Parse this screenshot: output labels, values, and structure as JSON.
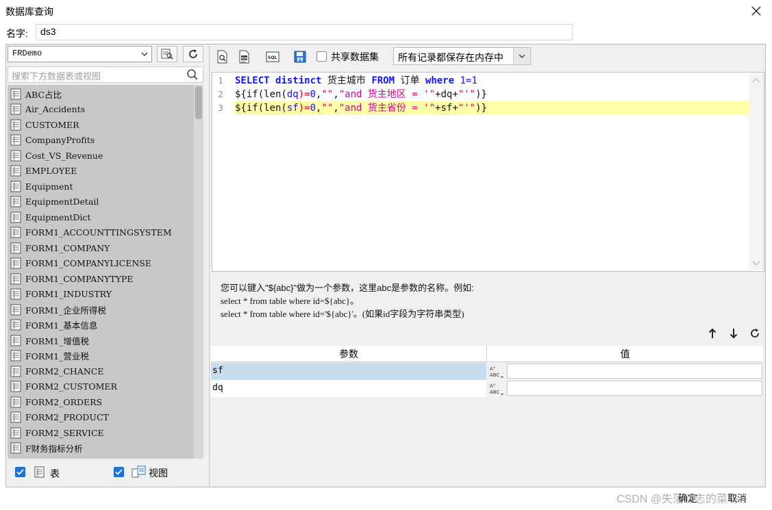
{
  "window": {
    "title": "数据库查询"
  },
  "name_field": {
    "label": "名字:",
    "value": "ds3"
  },
  "left": {
    "datasource": "FRDemo",
    "search_placeholder": "搜索下方数据表或视图",
    "tables": [
      "ABC占比",
      "Air_Accidents",
      "CUSTOMER",
      "CompanyProfits",
      "Cost_VS_Revenue",
      "EMPLOYEE",
      "Equipment",
      "EquipmentDetail",
      "EquipmentDict",
      "FORM1_ACCOUNTTINGSYSTEM",
      "FORM1_COMPANY",
      "FORM1_COMPANYLICENSE",
      "FORM1_COMPANYTYPE",
      "FORM1_INDUSTRY",
      "FORM1_企业所得税",
      "FORM1_基本信息",
      "FORM1_增值税",
      "FORM1_营业税",
      "FORM2_CHANCE",
      "FORM2_CUSTOMER",
      "FORM2_ORDERS",
      "FORM2_PRODUCT",
      "FORM2_SERVICE",
      "F财务指标分析"
    ],
    "filter_table_label": "表",
    "filter_view_label": "视图"
  },
  "toolbar": {
    "share_label": "共享数据集",
    "memory_option": "所有记录都保存在内存中"
  },
  "editor": {
    "lines": [
      {
        "num": "1",
        "highlight": false,
        "tokens": [
          {
            "t": "SELECT",
            "k": "kw"
          },
          {
            "t": " ",
            "k": "def"
          },
          {
            "t": "distinct",
            "k": "kw"
          },
          {
            "t": " 货主城市 ",
            "k": "def"
          },
          {
            "t": "FROM",
            "k": "kw"
          },
          {
            "t": " 订单 ",
            "k": "def"
          },
          {
            "t": "where",
            "k": "kw"
          },
          {
            "t": " ",
            "k": "def"
          },
          {
            "t": "1=1",
            "k": "num"
          }
        ]
      },
      {
        "num": "2",
        "highlight": false,
        "tokens": [
          {
            "t": "${if(len(",
            "k": "def"
          },
          {
            "t": "dq",
            "k": "num"
          },
          {
            "t": ")=",
            "k": "red"
          },
          {
            "t": "0",
            "k": "num"
          },
          {
            "t": ",",
            "k": "def"
          },
          {
            "t": "\"\"",
            "k": "str"
          },
          {
            "t": ",",
            "k": "def"
          },
          {
            "t": "\"and 货主地区 = '\"",
            "k": "str"
          },
          {
            "t": "+dq+",
            "k": "def"
          },
          {
            "t": "\"'\"",
            "k": "str"
          },
          {
            "t": ")}",
            "k": "def"
          }
        ]
      },
      {
        "num": "3",
        "highlight": true,
        "tokens": [
          {
            "t": "${if(len(",
            "k": "def"
          },
          {
            "t": "sf",
            "k": "num"
          },
          {
            "t": ")=",
            "k": "red"
          },
          {
            "t": "0",
            "k": "num"
          },
          {
            "t": ",",
            "k": "def"
          },
          {
            "t": "\"\"",
            "k": "str"
          },
          {
            "t": ",",
            "k": "def"
          },
          {
            "t": "\"and 货主省份 = '\"",
            "k": "str"
          },
          {
            "t": "+sf+",
            "k": "def"
          },
          {
            "t": "\"'\"",
            "k": "str"
          },
          {
            "t": ")}",
            "k": "def"
          }
        ]
      }
    ]
  },
  "hint": {
    "line1": "您可以键入\"${abc}\"做为一个参数，这里abc是参数的名称。例如:",
    "line2": "select * from table where id=${abc}。",
    "line3": "select * from table where id='${abc}'。(如果id字段为字符串类型)"
  },
  "params": {
    "header_param": "参数",
    "header_value": "值",
    "rows": [
      {
        "name": "sf",
        "value": "",
        "selected": true
      },
      {
        "name": "dq",
        "value": "",
        "selected": false
      }
    ]
  },
  "footer": {
    "watermark": "CSDN @失落斗志的菜鸟",
    "ok_label": "确定",
    "cancel_label": "取消"
  },
  "colors": {
    "accent": "#1a73d9",
    "keyword": "#1414ff",
    "string": "#d6008f",
    "selected_row": "#c7dced",
    "line_highlight": "#ffffa8"
  }
}
